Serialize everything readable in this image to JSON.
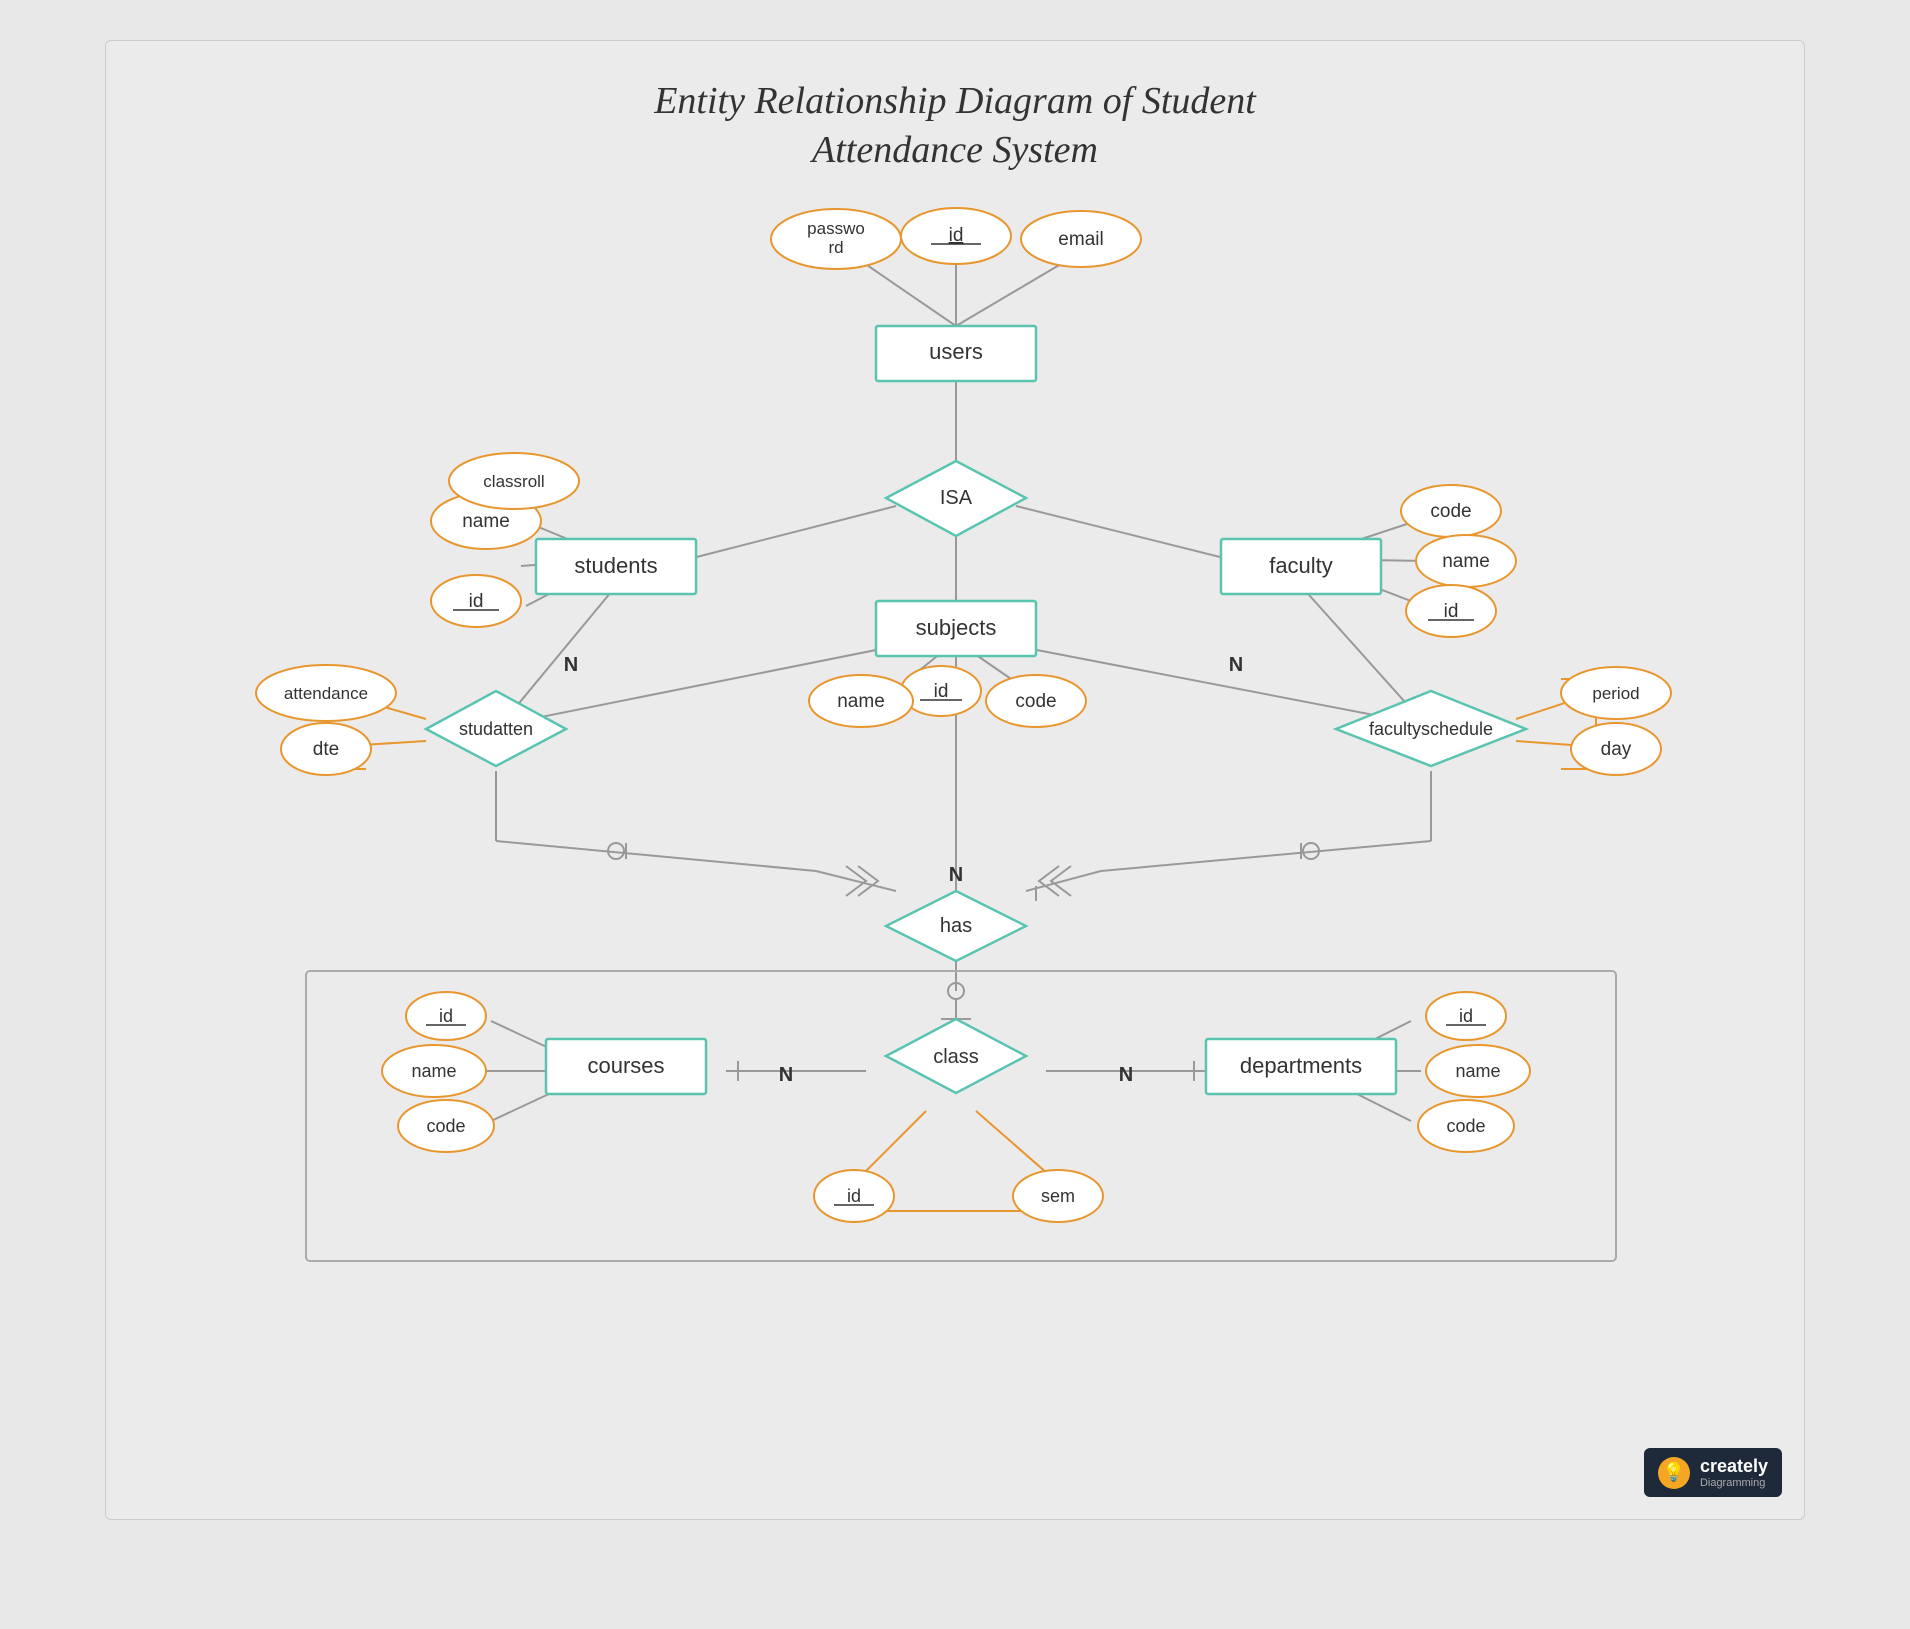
{
  "title": {
    "line1": "Entity Relationship Diagram of Student",
    "line2": "Attendance System"
  },
  "entities": {
    "users": "users",
    "students": "students",
    "faculty": "faculty",
    "subjects": "subjects",
    "courses": "courses",
    "departments": "departments",
    "class": "class"
  },
  "relationships": {
    "isa": "ISA",
    "studatten": "studatten",
    "facultyschedule": "facultyschedule",
    "has": "has"
  },
  "attributes": {
    "users_id": "id",
    "users_password": "password",
    "users_email": "email",
    "students_name": "name",
    "students_classroll": "classroll",
    "students_id": "id",
    "faculty_code": "code",
    "faculty_name": "name",
    "faculty_id": "id",
    "subjects_id": "id",
    "subjects_name": "name",
    "subjects_code": "code",
    "studatten_attendance": "attendance",
    "studatten_dte": "dte",
    "facultyschedule_period": "period",
    "facultyschedule_day": "day",
    "courses_id": "id",
    "courses_name": "name",
    "courses_code": "code",
    "departments_id": "id",
    "departments_name": "name",
    "departments_code": "code",
    "class_id": "id",
    "class_sem": "sem"
  },
  "creately": {
    "label": "creately",
    "sublabel": "Diagramming"
  }
}
